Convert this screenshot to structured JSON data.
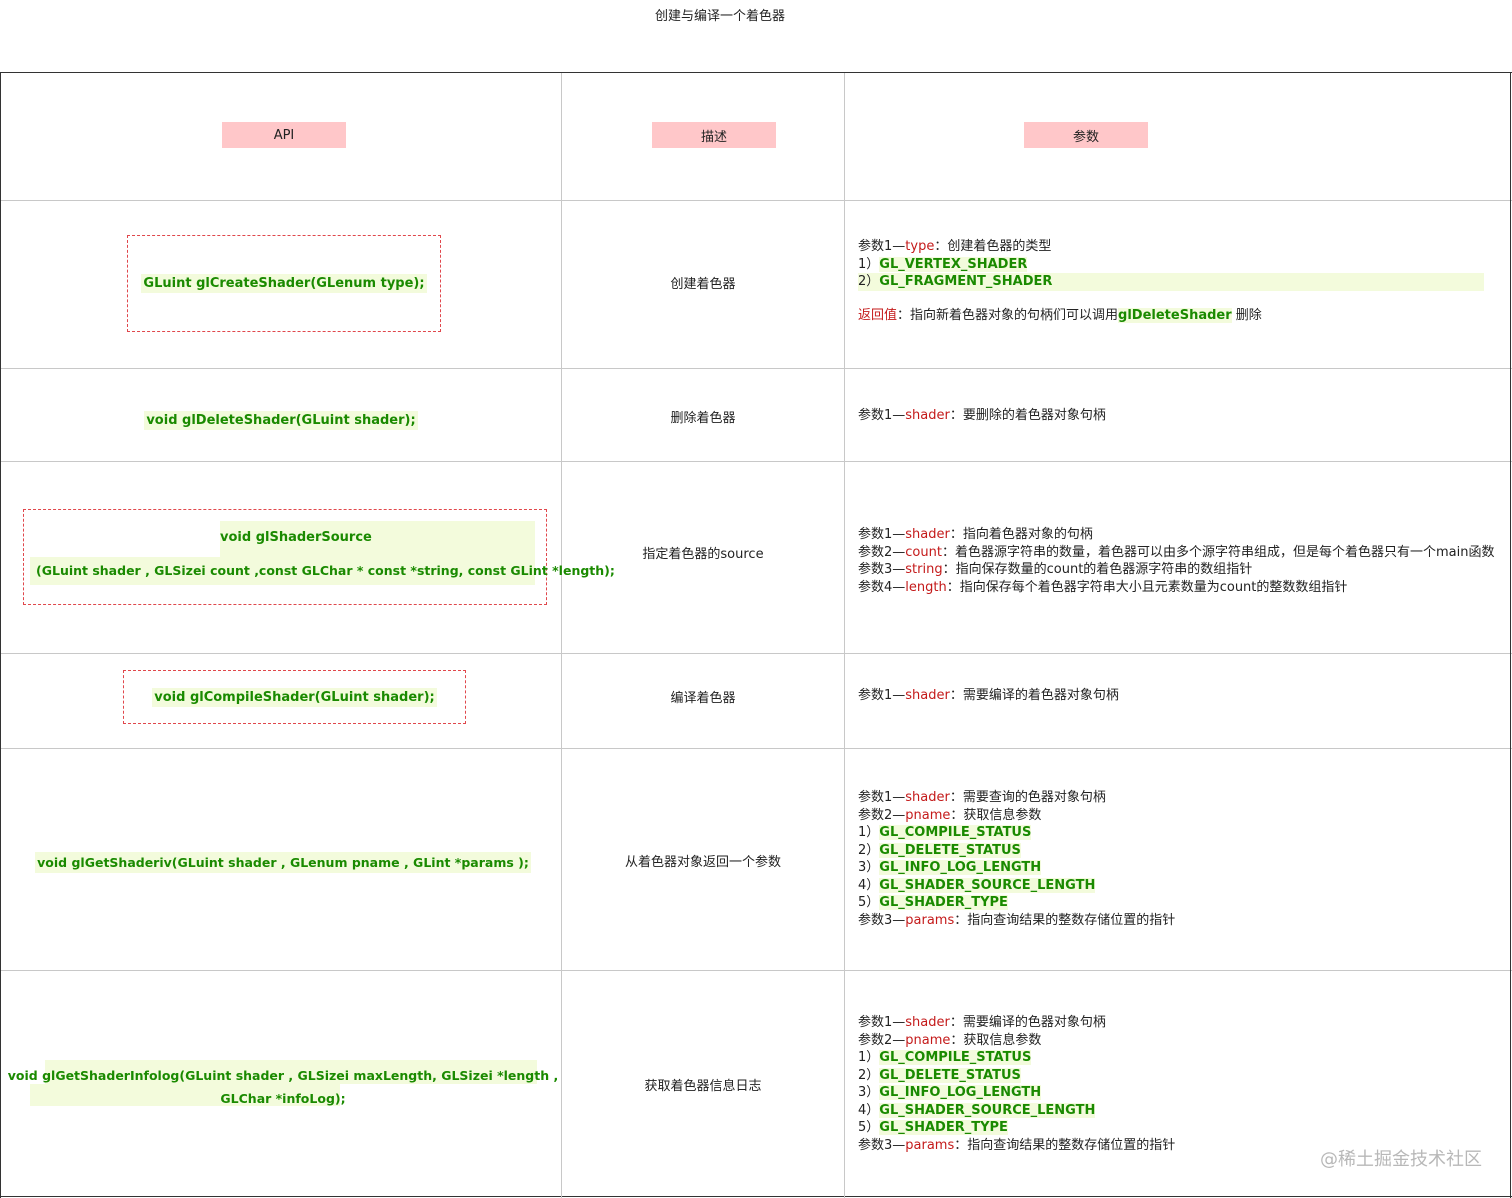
{
  "title": "创建与编译一个着色器",
  "headers": {
    "api": "API",
    "desc": "描述",
    "params": "参数"
  },
  "rows": [
    {
      "api": "GLuint glCreateShader(GLenum type);",
      "desc": "创建着色器",
      "p1_prefix": "参数1—",
      "p1_name": "type",
      "p1_text": "：创建着色器的类型",
      "e1_no": "1）",
      "e1_code": "GL_VERTEX_SHADER",
      "e2_no": "2）",
      "e2_code": "GL_FRAGMENT_SHADER",
      "ret_label": "返回值",
      "ret_text": "：指向新着色器对象的句柄们可以调用",
      "ret_code": "glDeleteShader",
      "ret_tail": " 删除"
    },
    {
      "api": "void glDeleteShader(GLuint shader);",
      "desc": "删除着色器",
      "p1_prefix": "参数1—",
      "p1_name": "shader",
      "p1_text": "：要删除的着色器对象句柄"
    },
    {
      "api_line1": "void glShaderSource",
      "api_line2": "(GLuint shader , GLSizei count ,const GLChar * const *string, const GLint *length);",
      "desc": "指定着色器的source",
      "p1_prefix": "参数1—",
      "p1_name": "shader",
      "p1_text": "：指向着色器对象的句柄",
      "p2_prefix": "参数2—",
      "p2_name": "count",
      "p2_text": "：着色器源字符串的数量，着色器可以由多个源字符串组成，但是每个着色器只有一个main函数",
      "p3_prefix": "参数3—",
      "p3_name": "string",
      "p3_text": "：指向保存数量的count的着色器源字符串的数组指针",
      "p4_prefix": "参数4—",
      "p4_name": "length",
      "p4_text": "：指向保存每个着色器字符串大小且元素数量为count的整数数组指针"
    },
    {
      "api": "void glCompileShader(GLuint shader);",
      "desc": "编译着色器",
      "p1_prefix": "参数1—",
      "p1_name": "shader",
      "p1_text": "：需要编译的着色器对象句柄"
    },
    {
      "api": "void glGetShaderiv(GLuint shader , GLenum pname , GLint *params );",
      "desc": "从着色器对象返回一个参数",
      "p1_prefix": "参数1—",
      "p1_name": "shader",
      "p1_text": "：需要查询的色器对象句柄",
      "p2_prefix": "参数2—",
      "p2_name": "pname",
      "p2_text": "：获取信息参数",
      "e1_no": "1）",
      "e1_code": "GL_COMPILE_STATUS",
      "e2_no": "2）",
      "e2_code": "GL_DELETE_STATUS",
      "e3_no": "3）",
      "e3_code": "GL_INFO_LOG_LENGTH",
      "e4_no": "4）",
      "e4_code": "GL_SHADER_SOURCE_LENGTH",
      "e5_no": "5）",
      "e5_code": "GL_SHADER_TYPE",
      "p3_prefix": "参数3—",
      "p3_name": "params",
      "p3_text": "：指向查询结果的整数存储位置的指针"
    },
    {
      "api_line1": "void glGetShaderInfolog(GLuint shader , GLSizei maxLength, GLSizei *length ,",
      "api_line2": "GLChar *infoLog);",
      "desc": "获取着色器信息日志",
      "p1_prefix": "参数1—",
      "p1_name": "shader",
      "p1_text": "：需要编译的色器对象句柄",
      "p2_prefix": "参数2—",
      "p2_name": "pname",
      "p2_text": "：获取信息参数",
      "e1_no": "1）",
      "e1_code": "GL_COMPILE_STATUS",
      "e2_no": "2）",
      "e2_code": "GL_DELETE_STATUS",
      "e3_no": "3）",
      "e3_code": "GL_INFO_LOG_LENGTH",
      "e4_no": "4）",
      "e4_code": "GL_SHADER_SOURCE_LENGTH",
      "e5_no": "5）",
      "e5_code": "GL_SHADER_TYPE",
      "p3_prefix": "参数3—",
      "p3_name": "params",
      "p3_text": "：指向查询结果的整数存储位置的指针"
    }
  ],
  "watermark": "@稀土掘金技术社区",
  "colors": {
    "header_fill": "#ffc7c9",
    "code_green": "#1a8a00",
    "code_highlight": "#f3fbdc",
    "param_red": "#c41a1a",
    "dashed_border": "#e0474c"
  }
}
